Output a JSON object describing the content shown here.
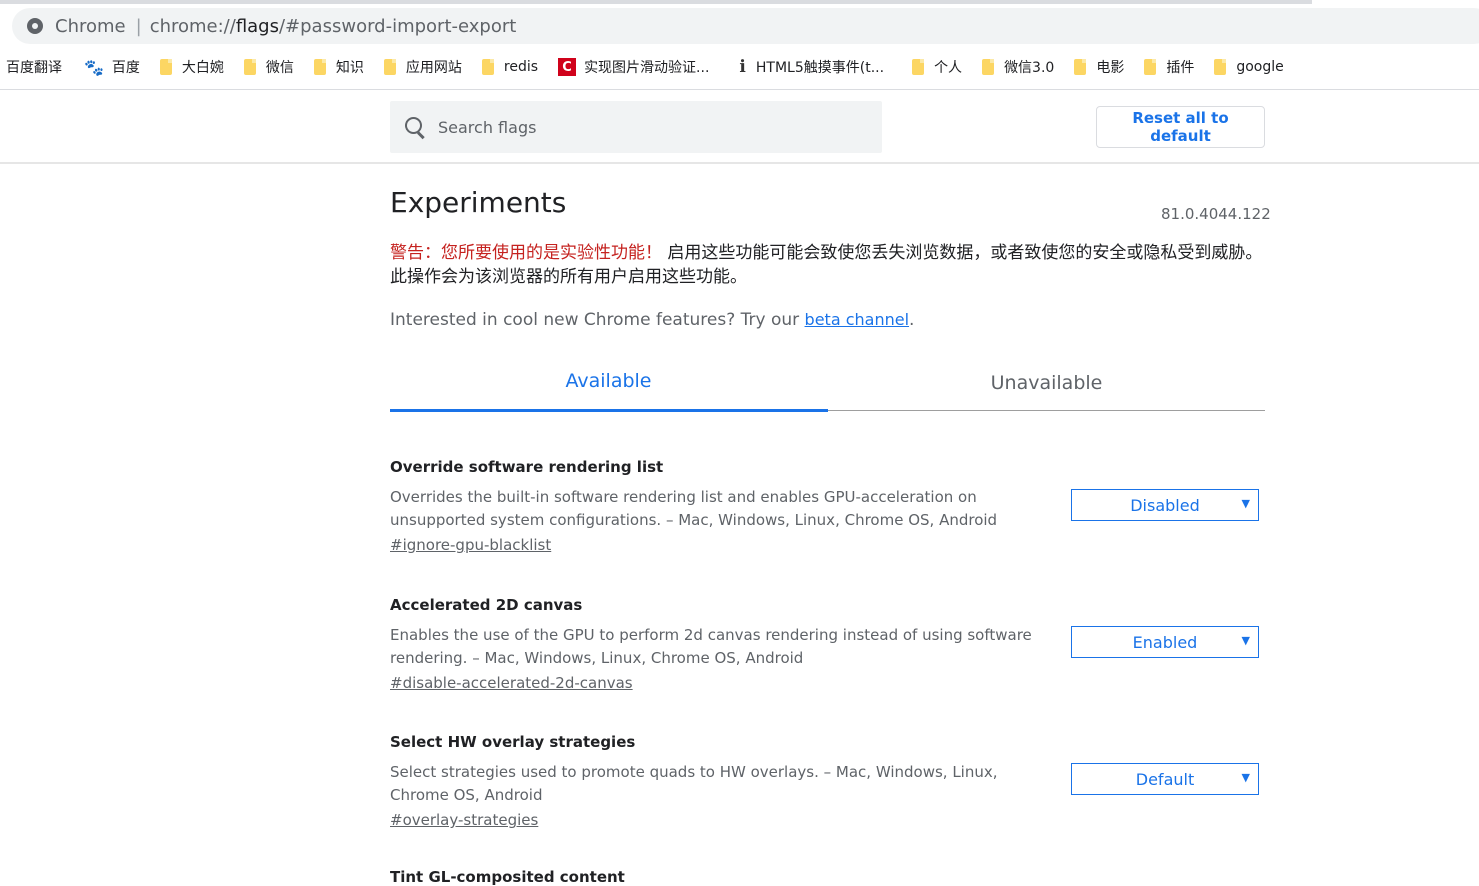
{
  "browser": {
    "site_name": "Chrome",
    "url_prefix": "chrome://",
    "url_host": "flags",
    "url_path": "/#password-import-export"
  },
  "bookmarks": [
    {
      "label": "百度翻译",
      "icon": "none"
    },
    {
      "label": "百度",
      "icon": "baidu-paw-icon"
    },
    {
      "label": "大白婉",
      "icon": "folder-icon"
    },
    {
      "label": "微信",
      "icon": "folder-icon"
    },
    {
      "label": "知识",
      "icon": "folder-icon"
    },
    {
      "label": "应用网站",
      "icon": "folder-icon"
    },
    {
      "label": "redis",
      "icon": "folder-icon"
    },
    {
      "label": "实现图片滑动验证...",
      "icon": "red-c-icon"
    },
    {
      "label": "HTML5触摸事件(t...",
      "icon": "glyph-icon"
    },
    {
      "label": "个人",
      "icon": "folder-icon"
    },
    {
      "label": "微信3.0",
      "icon": "folder-icon"
    },
    {
      "label": "电影",
      "icon": "folder-icon"
    },
    {
      "label": "插件",
      "icon": "folder-icon"
    },
    {
      "label": "google",
      "icon": "folder-icon"
    }
  ],
  "header": {
    "search_placeholder": "Search flags",
    "reset_label": "Reset all to default"
  },
  "main": {
    "title": "Experiments",
    "version": "81.0.4044.122",
    "warning_red": "警告：您所要使用的是实验性功能！",
    "warning_text": " 启用这些功能可能会致使您丢失浏览数据，或者致使您的安全或隐私受到威胁。此操作会为该浏览器的所有用户启用这些功能。",
    "promo_text": "Interested in cool new Chrome features? Try our ",
    "promo_link": "beta channel",
    "promo_end": ".",
    "tabs": [
      {
        "label": "Available",
        "active": true
      },
      {
        "label": "Unavailable",
        "active": false
      }
    ],
    "flags": [
      {
        "name": "Override software rendering list",
        "description": "Overrides the built-in software rendering list and enables GPU-acceleration on unsupported system configurations. – Mac, Windows, Linux, Chrome OS, Android",
        "link": "#ignore-gpu-blacklist",
        "value": "Disabled"
      },
      {
        "name": "Accelerated 2D canvas",
        "description": "Enables the use of the GPU to perform 2d canvas rendering instead of using software rendering. – Mac, Windows, Linux, Chrome OS, Android",
        "link": "#disable-accelerated-2d-canvas",
        "value": "Enabled"
      },
      {
        "name": "Select HW overlay strategies",
        "description": "Select strategies used to promote quads to HW overlays. – Mac, Windows, Linux, Chrome OS, Android",
        "link": "#overlay-strategies",
        "value": "Default"
      },
      {
        "name": "Tint GL-composited content"
      }
    ]
  },
  "colors": {
    "accent": "#1a73e8",
    "warning": "#c5221f",
    "muted_text": "#5f6368"
  }
}
